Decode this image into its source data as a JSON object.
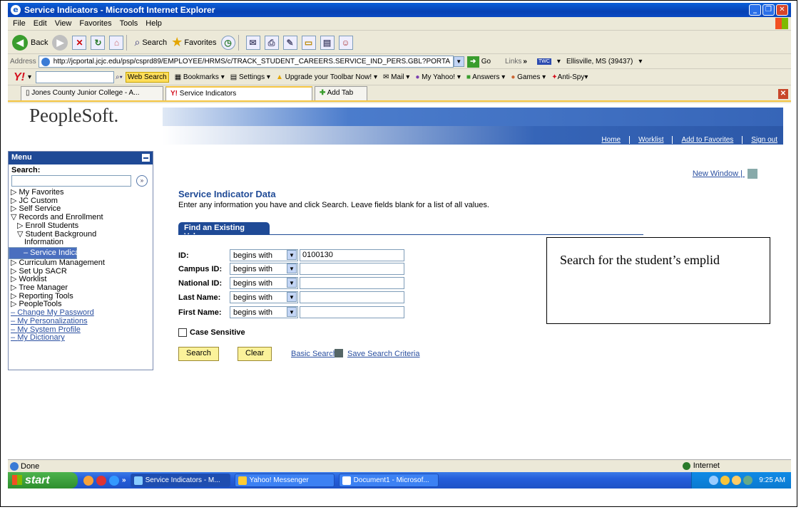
{
  "window": {
    "title": "Service Indicators - Microsoft Internet Explorer"
  },
  "menubar": [
    "File",
    "Edit",
    "View",
    "Favorites",
    "Tools",
    "Help"
  ],
  "toolbar": {
    "back": "Back",
    "search": "Search",
    "favorites": "Favorites"
  },
  "address": {
    "label": "Address",
    "url": "http://jcportal.jcjc.edu/psp/csprd89/EMPLOYEE/HRMS/c/TRACK_STUDENT_CAREERS.SERVICE_IND_PERS.GBL?PORTA",
    "go": "Go",
    "links": "Links",
    "weather_badge": "TWC",
    "weather": "Ellisville, MS (39437)"
  },
  "yahoo": {
    "logo": "Y!",
    "web_search": "Web Search",
    "bookmarks": "Bookmarks",
    "settings": "Settings",
    "upgrade": "Upgrade your Toolbar Now!",
    "mail": "Mail",
    "my_yahoo": "My Yahoo!",
    "answers": "Answers",
    "games": "Games",
    "antispy": "Anti-Spy"
  },
  "tabs": [
    {
      "label": "Jones County Junior College - A..."
    },
    {
      "label": "Service Indicators"
    },
    {
      "label": "Add Tab"
    }
  ],
  "peoplesoft": {
    "logo": "PeopleSoft.",
    "links": [
      "Home",
      "Worklist",
      "Add to Favorites",
      "Sign out"
    ]
  },
  "menu": {
    "title": "Menu",
    "search_label": "Search:",
    "items": [
      "My Favorites",
      "JC Custom",
      "Self Service",
      "Records and Enrollment",
      "Enroll Students",
      "Student Background",
      "Information",
      "– Service Indicators",
      "Curriculum Management",
      "Set Up SACR",
      "Worklist",
      "Tree Manager",
      "Reporting Tools",
      "PeopleTools",
      "Change My Password",
      "My Personalizations",
      "My System Profile",
      "My Dictionary"
    ]
  },
  "page": {
    "new_window": "New Window",
    "heading": "Service Indicator Data",
    "instructions": "Enter any information you have and click Search. Leave fields blank for a list of all values.",
    "find_tab": "Find an Existing Value",
    "fields": [
      {
        "label": "ID:",
        "operator": "begins with",
        "value": "0100130"
      },
      {
        "label": "Campus ID:",
        "operator": "begins with",
        "value": ""
      },
      {
        "label": "National ID:",
        "operator": "begins with",
        "value": ""
      },
      {
        "label": "Last Name:",
        "operator": "begins with",
        "value": ""
      },
      {
        "label": "First Name:",
        "operator": "begins with",
        "value": ""
      }
    ],
    "case_sensitive": "Case Sensitive",
    "search_btn": "Search",
    "clear_btn": "Clear",
    "basic_search": "Basic Search",
    "save_search": "Save Search Criteria"
  },
  "callout": "Search for the student’s emplid",
  "status": {
    "left": "Done",
    "zone": "Internet"
  },
  "taskbar": {
    "start": "start",
    "tasks": [
      "Service Indicators - M...",
      "Yahoo! Messenger",
      "Document1 - Microsof..."
    ],
    "clock": "9:25 AM"
  }
}
